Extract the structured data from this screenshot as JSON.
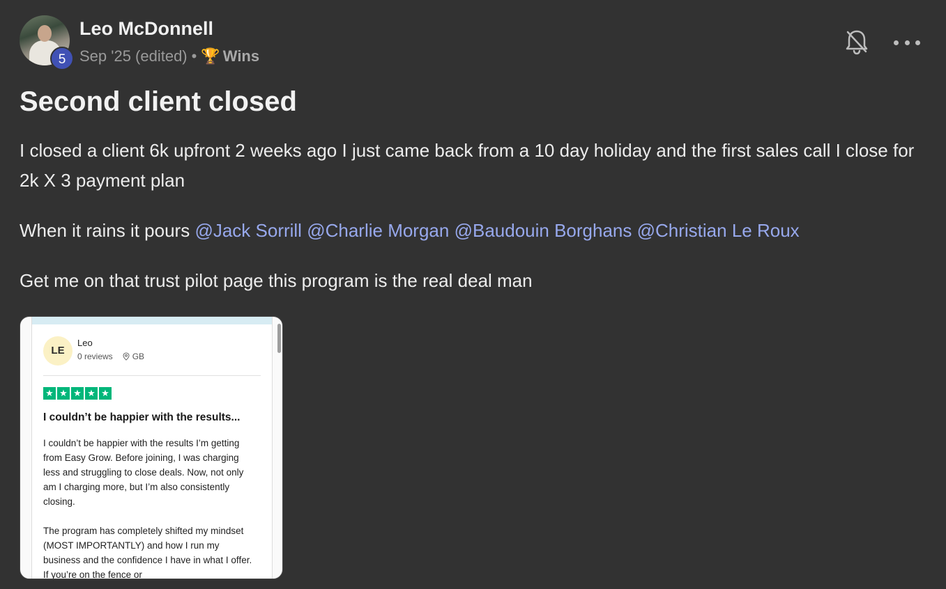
{
  "post": {
    "author": {
      "name": "Leo McDonnell",
      "level": "5"
    },
    "date": "Sep '25 (edited)",
    "separator": "•",
    "category": {
      "icon": "trophy-icon",
      "emoji": "🏆",
      "label": "Wins"
    },
    "title": "Second client closed",
    "paragraph1": "I closed a client 6k upfront 2 weeks ago I just came back from a 10 day holiday and the first sales call I close for 2k X 3 payment plan",
    "paragraph2": {
      "text": "When it rains it pours ",
      "mentions": [
        "@Jack Sorrill",
        "@Charlie Morgan",
        "@Baudouin Borghans",
        "@Christian Le Roux"
      ]
    },
    "paragraph3": "Get me on that trust pilot page this program is the real deal man",
    "actions": {
      "bell_icon": "bell-off-icon",
      "more_icon": "more-horizontal-icon"
    },
    "colors": {
      "background": "#323232",
      "mention": "#97a8ec",
      "level_badge": "#4051b5",
      "trustpilot_green": "#00b67a"
    }
  },
  "attachment": {
    "reviewer_initials": "LE",
    "reviewer_name": "Leo",
    "reviews": "0 reviews",
    "country": "GB",
    "rating": 5,
    "star_glyph": "★",
    "review_title": "I couldn’t be happier with the results...",
    "review_body_1": "I couldn’t be happier with the results I’m getting from Easy Grow. Before joining, I was charging less and struggling to close deals. Now, not only am I charging more, but I’m also consistently closing.",
    "review_body_2": "The program has completely shifted my mindset (MOST IMPORTANTLY) and how I run my business and the confidence I have in what I offer. If you’re on the fence or"
  }
}
